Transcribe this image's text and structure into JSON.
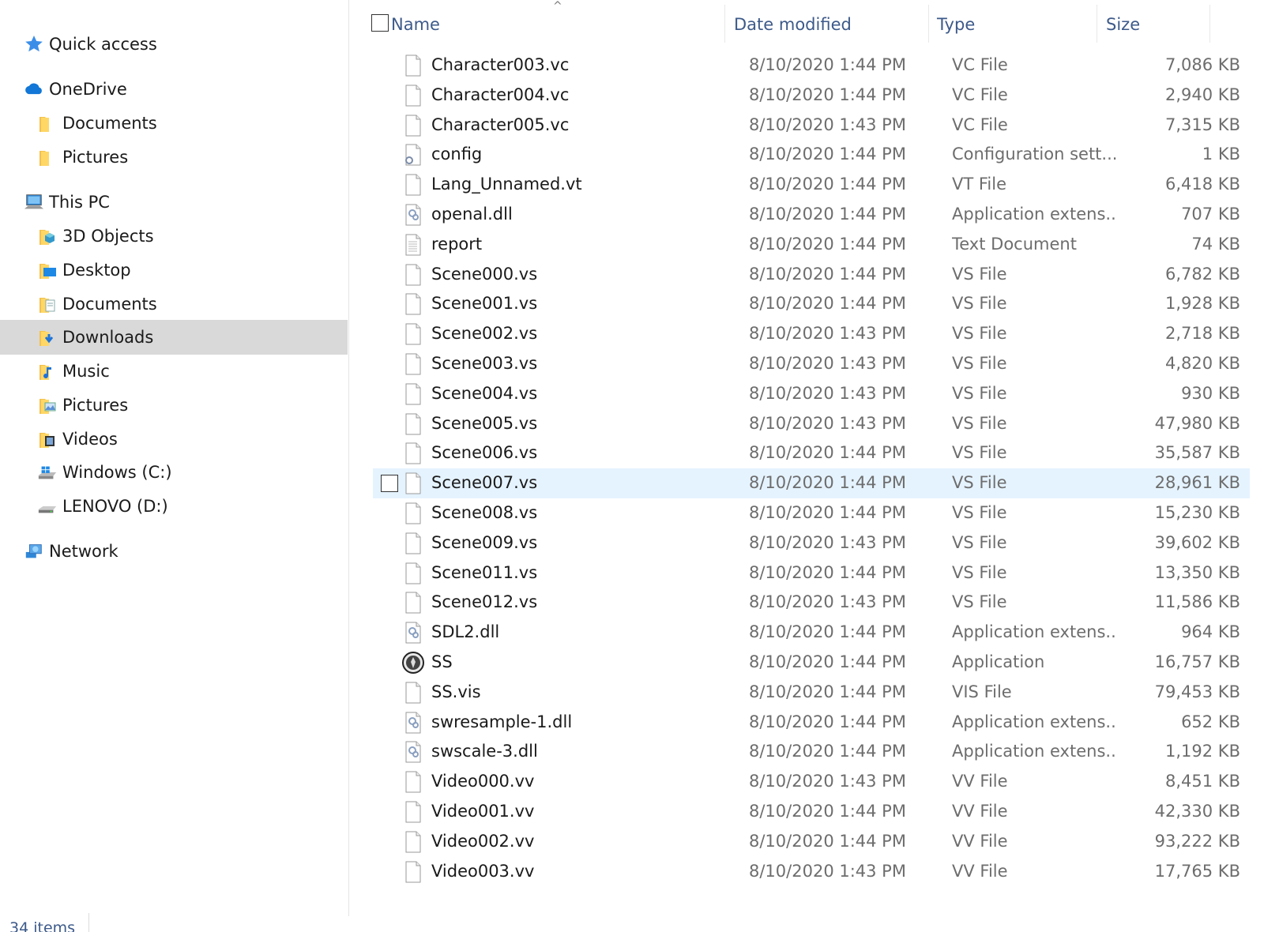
{
  "nav": {
    "items": [
      {
        "label": "Quick access",
        "icon": "star-icon",
        "level": 0,
        "name": "nav-quick-access"
      },
      {
        "label": "OneDrive",
        "icon": "cloud-icon",
        "level": 0,
        "name": "nav-onedrive"
      },
      {
        "label": "Documents",
        "icon": "folder-icon",
        "level": 1,
        "name": "nav-onedrive-documents"
      },
      {
        "label": "Pictures",
        "icon": "folder-icon",
        "level": 1,
        "name": "nav-onedrive-pictures"
      },
      {
        "label": "This PC",
        "icon": "computer-icon",
        "level": 0,
        "name": "nav-this-pc"
      },
      {
        "label": "3D Objects",
        "icon": "3d-objects-folder-icon",
        "level": 1,
        "name": "nav-3d-objects"
      },
      {
        "label": "Desktop",
        "icon": "desktop-folder-icon",
        "level": 1,
        "name": "nav-desktop"
      },
      {
        "label": "Documents",
        "icon": "documents-folder-icon",
        "level": 1,
        "name": "nav-documents"
      },
      {
        "label": "Downloads",
        "icon": "downloads-folder-icon",
        "level": 1,
        "name": "nav-downloads",
        "selected": true
      },
      {
        "label": "Music",
        "icon": "music-folder-icon",
        "level": 1,
        "name": "nav-music"
      },
      {
        "label": "Pictures",
        "icon": "pictures-folder-icon",
        "level": 1,
        "name": "nav-pictures"
      },
      {
        "label": "Videos",
        "icon": "videos-folder-icon",
        "level": 1,
        "name": "nav-videos"
      },
      {
        "label": "Windows (C:)",
        "icon": "windows-drive-icon",
        "level": 1,
        "name": "nav-drive-c"
      },
      {
        "label": "LENOVO (D:)",
        "icon": "drive-icon",
        "level": 1,
        "name": "nav-drive-d"
      },
      {
        "label": "Network",
        "icon": "network-icon",
        "level": 0,
        "name": "nav-network"
      }
    ]
  },
  "header": {
    "name": "Name",
    "date_modified": "Date modified",
    "type": "Type",
    "size": "Size",
    "sort_indicator": "^"
  },
  "files": [
    {
      "name": "Character003.vc",
      "date": "8/10/2020 1:44 PM",
      "type": "VC File",
      "size": "7,086 KB",
      "icon": "blank-file-icon"
    },
    {
      "name": "Character004.vc",
      "date": "8/10/2020 1:44 PM",
      "type": "VC File",
      "size": "2,940 KB",
      "icon": "blank-file-icon"
    },
    {
      "name": "Character005.vc",
      "date": "8/10/2020 1:43 PM",
      "type": "VC File",
      "size": "7,315 KB",
      "icon": "blank-file-icon"
    },
    {
      "name": "config",
      "date": "8/10/2020 1:44 PM",
      "type": "Configuration sett...",
      "size": "1 KB",
      "icon": "config-file-icon"
    },
    {
      "name": "Lang_Unnamed.vt",
      "date": "8/10/2020 1:44 PM",
      "type": "VT File",
      "size": "6,418 KB",
      "icon": "blank-file-icon"
    },
    {
      "name": "openal.dll",
      "date": "8/10/2020 1:44 PM",
      "type": "Application extens...",
      "size": "707 KB",
      "icon": "dll-file-icon"
    },
    {
      "name": "report",
      "date": "8/10/2020 1:44 PM",
      "type": "Text Document",
      "size": "74 KB",
      "icon": "text-file-icon"
    },
    {
      "name": "Scene000.vs",
      "date": "8/10/2020 1:44 PM",
      "type": "VS File",
      "size": "6,782 KB",
      "icon": "blank-file-icon"
    },
    {
      "name": "Scene001.vs",
      "date": "8/10/2020 1:44 PM",
      "type": "VS File",
      "size": "1,928 KB",
      "icon": "blank-file-icon"
    },
    {
      "name": "Scene002.vs",
      "date": "8/10/2020 1:43 PM",
      "type": "VS File",
      "size": "2,718 KB",
      "icon": "blank-file-icon"
    },
    {
      "name": "Scene003.vs",
      "date": "8/10/2020 1:43 PM",
      "type": "VS File",
      "size": "4,820 KB",
      "icon": "blank-file-icon"
    },
    {
      "name": "Scene004.vs",
      "date": "8/10/2020 1:43 PM",
      "type": "VS File",
      "size": "930 KB",
      "icon": "blank-file-icon"
    },
    {
      "name": "Scene005.vs",
      "date": "8/10/2020 1:43 PM",
      "type": "VS File",
      "size": "47,980 KB",
      "icon": "blank-file-icon"
    },
    {
      "name": "Scene006.vs",
      "date": "8/10/2020 1:44 PM",
      "type": "VS File",
      "size": "35,587 KB",
      "icon": "blank-file-icon"
    },
    {
      "name": "Scene007.vs",
      "date": "8/10/2020 1:44 PM",
      "type": "VS File",
      "size": "28,961 KB",
      "icon": "blank-file-icon",
      "hovered": true
    },
    {
      "name": "Scene008.vs",
      "date": "8/10/2020 1:44 PM",
      "type": "VS File",
      "size": "15,230 KB",
      "icon": "blank-file-icon"
    },
    {
      "name": "Scene009.vs",
      "date": "8/10/2020 1:43 PM",
      "type": "VS File",
      "size": "39,602 KB",
      "icon": "blank-file-icon"
    },
    {
      "name": "Scene011.vs",
      "date": "8/10/2020 1:44 PM",
      "type": "VS File",
      "size": "13,350 KB",
      "icon": "blank-file-icon"
    },
    {
      "name": "Scene012.vs",
      "date": "8/10/2020 1:43 PM",
      "type": "VS File",
      "size": "11,586 KB",
      "icon": "blank-file-icon"
    },
    {
      "name": "SDL2.dll",
      "date": "8/10/2020 1:44 PM",
      "type": "Application extens...",
      "size": "964 KB",
      "icon": "dll-file-icon"
    },
    {
      "name": "SS",
      "date": "8/10/2020 1:44 PM",
      "type": "Application",
      "size": "16,757 KB",
      "icon": "application-icon"
    },
    {
      "name": "SS.vis",
      "date": "8/10/2020 1:44 PM",
      "type": "VIS File",
      "size": "79,453 KB",
      "icon": "blank-file-icon"
    },
    {
      "name": "swresample-1.dll",
      "date": "8/10/2020 1:44 PM",
      "type": "Application extens...",
      "size": "652 KB",
      "icon": "dll-file-icon"
    },
    {
      "name": "swscale-3.dll",
      "date": "8/10/2020 1:44 PM",
      "type": "Application extens...",
      "size": "1,192 KB",
      "icon": "dll-file-icon"
    },
    {
      "name": "Video000.vv",
      "date": "8/10/2020 1:43 PM",
      "type": "VV File",
      "size": "8,451 KB",
      "icon": "blank-file-icon"
    },
    {
      "name": "Video001.vv",
      "date": "8/10/2020 1:44 PM",
      "type": "VV File",
      "size": "42,330 KB",
      "icon": "blank-file-icon"
    },
    {
      "name": "Video002.vv",
      "date": "8/10/2020 1:44 PM",
      "type": "VV File",
      "size": "93,222 KB",
      "icon": "blank-file-icon"
    },
    {
      "name": "Video003.vv",
      "date": "8/10/2020 1:43 PM",
      "type": "VV File",
      "size": "17,765 KB",
      "icon": "blank-file-icon"
    }
  ],
  "status": {
    "item_count": "34 items"
  },
  "colors": {
    "header_text": "#3d5a8a",
    "selected_nav": "#d9d9d9",
    "hover_row": "#e5f3ff",
    "secondary_text": "#6d6d6d"
  }
}
